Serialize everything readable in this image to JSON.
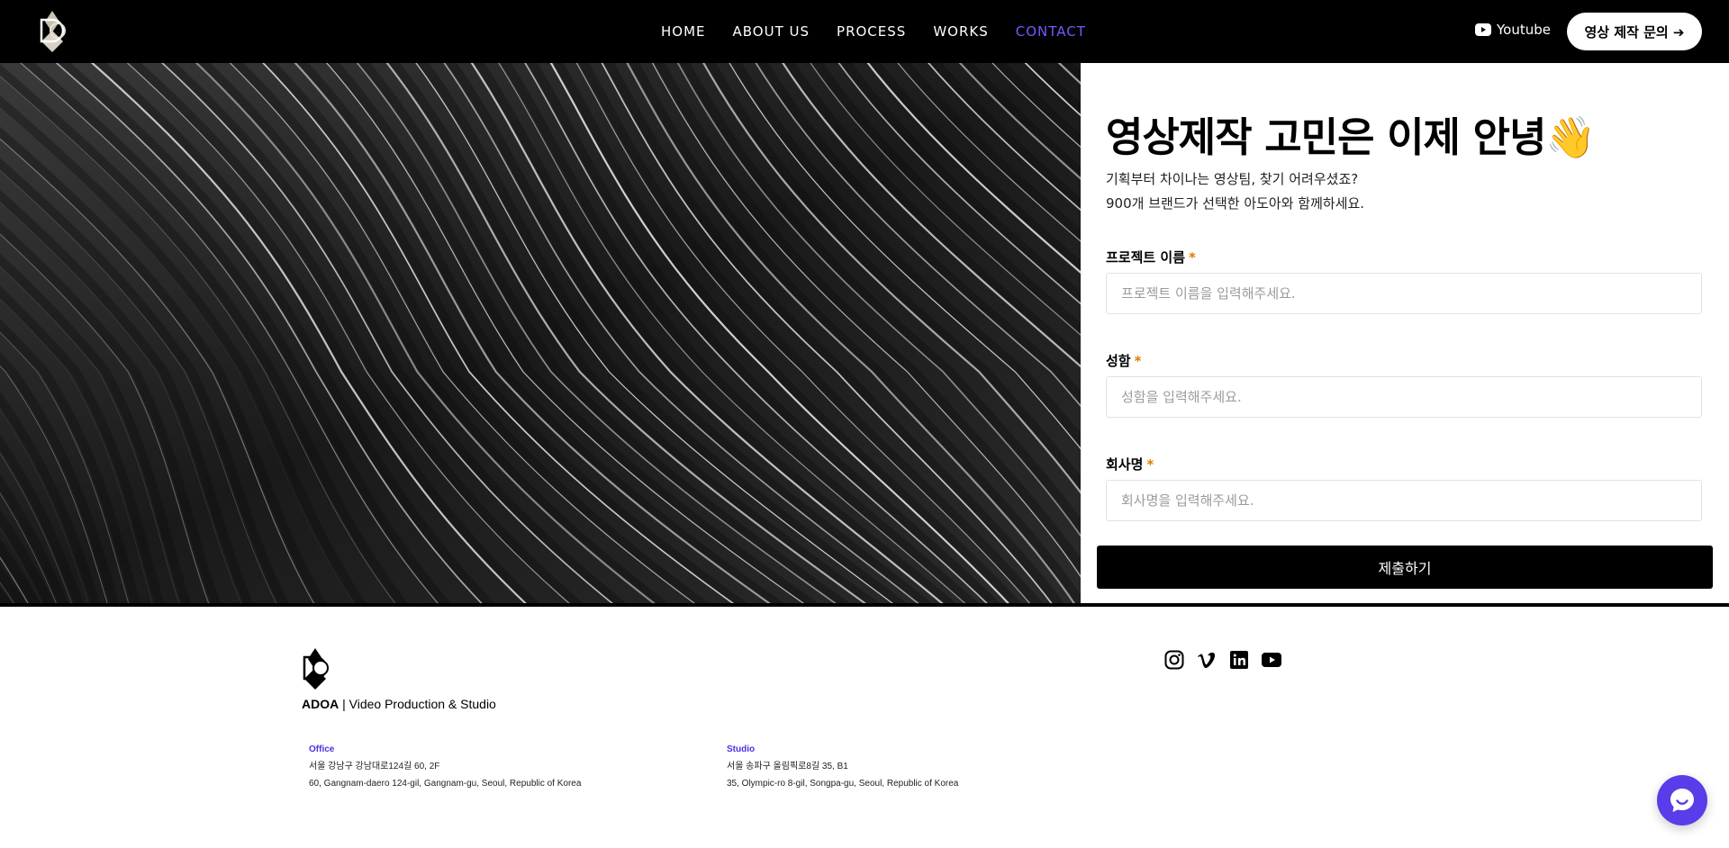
{
  "header": {
    "logo_name": "ADOA logo",
    "nav": [
      {
        "label": "HOME"
      },
      {
        "label": "ABOUT US"
      },
      {
        "label": "PROCESS"
      },
      {
        "label": "WORKS"
      },
      {
        "label": "CONTACT",
        "active": true
      }
    ],
    "youtube_label": "Youtube",
    "cta_label": "영상 제작 문의 ➔"
  },
  "colors": {
    "accent": "#6f5cff",
    "required": "#e07a00",
    "chat": "#5a3ce8"
  },
  "form": {
    "title": "영상제작 고민은 이제 안녕👋",
    "subtitle_line1": "기획부터 차이나는 영상팀, 찾기 어려우셨죠?",
    "subtitle_line2": "900개 브랜드가 선택한 아도아와 함께하세요.",
    "required_mark": "*",
    "fields": [
      {
        "label": "프로젝트 이름",
        "placeholder": "프로젝트 이름을 입력해주세요.",
        "value": ""
      },
      {
        "label": "성함",
        "placeholder": "성함을 입력해주세요.",
        "value": ""
      },
      {
        "label": "회사명",
        "placeholder": "회사명을 입력해주세요.",
        "value": ""
      }
    ],
    "submit_label": "제출하기"
  },
  "footer": {
    "brand_name": "ADOA",
    "brand_tagline": "| Video Production & Studio",
    "social_icons": [
      "instagram-icon",
      "vimeo-icon",
      "linkedin-icon",
      "youtube-icon"
    ],
    "office": {
      "label": "Office",
      "line1": "서울 강남구 강남대로124길 60, 2F",
      "line2": "60, Gangnam-daero 124-gil, Gangnam-gu, Seoul, Republic of Korea"
    },
    "studio": {
      "label": "Studio",
      "line1": "서울 송파구 올림픽로8길 35, B1",
      "line2": "35, Olympic-ro 8-gil, Songpa-gu, Seoul, Republic of Korea"
    }
  }
}
